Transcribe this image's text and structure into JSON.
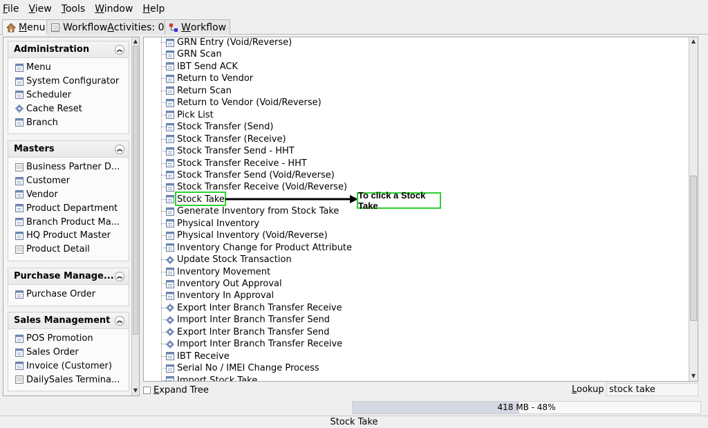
{
  "menubar": {
    "items": [
      {
        "pre": "",
        "u": "F",
        "post": "ile"
      },
      {
        "pre": "",
        "u": "V",
        "post": "iew"
      },
      {
        "pre": "",
        "u": "T",
        "post": "ools"
      },
      {
        "pre": "",
        "u": "W",
        "post": "indow"
      },
      {
        "pre": "",
        "u": "H",
        "post": "elp"
      }
    ]
  },
  "tabs": [
    {
      "pre": "",
      "u": "M",
      "post": "enu",
      "icon": "home-icon"
    },
    {
      "pre": "Workflow ",
      "u": "A",
      "post": "ctivities: 0",
      "icon": "list-icon"
    },
    {
      "pre": "",
      "u": "W",
      "post": "orkflow",
      "icon": "workflow-icon"
    }
  ],
  "sidebar": {
    "sections": [
      {
        "title": "Administration",
        "items": [
          {
            "label": "Menu",
            "icon": "window-icon"
          },
          {
            "label": "System Configurator",
            "icon": "window-icon"
          },
          {
            "label": "Scheduler",
            "icon": "window-icon"
          },
          {
            "label": "Cache Reset",
            "icon": "gear-icon"
          },
          {
            "label": "Branch",
            "icon": "window-icon"
          }
        ]
      },
      {
        "title": "Masters",
        "items": [
          {
            "label": "Business Partner D...",
            "icon": "form-icon"
          },
          {
            "label": "Customer",
            "icon": "window-icon"
          },
          {
            "label": "Vendor",
            "icon": "window-icon"
          },
          {
            "label": "Product Department",
            "icon": "window-icon"
          },
          {
            "label": "Branch Product Ma...",
            "icon": "window-icon"
          },
          {
            "label": "HQ Product Master",
            "icon": "window-icon"
          },
          {
            "label": "Product Detail",
            "icon": "form-icon"
          }
        ]
      },
      {
        "title": "Purchase Manage...",
        "items": [
          {
            "label": "Purchase Order",
            "icon": "window-icon"
          }
        ]
      },
      {
        "title": "Sales Management",
        "items": [
          {
            "label": "POS Promotion",
            "icon": "window-icon"
          },
          {
            "label": "Sales Order",
            "icon": "window-icon"
          },
          {
            "label": "Invoice (Customer)",
            "icon": "window-icon"
          },
          {
            "label": "DailySales Termina...",
            "icon": "form-icon"
          }
        ]
      }
    ]
  },
  "tree": {
    "items": [
      {
        "label": "GRN Entry (Void/Reverse)",
        "icon": "window-icon"
      },
      {
        "label": "GRN Scan",
        "icon": "window-icon"
      },
      {
        "label": "IBT Send ACK",
        "icon": "window-icon"
      },
      {
        "label": "Return to Vendor",
        "icon": "window-icon"
      },
      {
        "label": "Return Scan",
        "icon": "window-icon"
      },
      {
        "label": "Return to Vendor (Void/Reverse)",
        "icon": "window-icon"
      },
      {
        "label": "Pick List",
        "icon": "window-icon"
      },
      {
        "label": "Stock Transfer (Send)",
        "icon": "window-icon"
      },
      {
        "label": "Stock Transfer (Receive)",
        "icon": "window-icon"
      },
      {
        "label": "Stock Transfer Send - HHT",
        "icon": "window-icon"
      },
      {
        "label": "Stock Transfer Receive - HHT",
        "icon": "window-icon"
      },
      {
        "label": "Stock Transfer Send (Void/Reverse)",
        "icon": "window-icon"
      },
      {
        "label": "Stock Transfer Receive (Void/Reverse)",
        "icon": "window-icon"
      },
      {
        "label": "Stock Take",
        "icon": "window-icon"
      },
      {
        "label": "Generate Inventory from Stock Take",
        "icon": "window-icon"
      },
      {
        "label": "Physical Inventory",
        "icon": "window-icon"
      },
      {
        "label": "Physical Inventory (Void/Reverse)",
        "icon": "window-icon"
      },
      {
        "label": "Inventory Change for Product Attribute",
        "icon": "window-icon"
      },
      {
        "label": "Update Stock Transaction",
        "icon": "gear-icon"
      },
      {
        "label": "Inventory Movement",
        "icon": "window-icon"
      },
      {
        "label": "Inventory Out Approval",
        "icon": "window-icon"
      },
      {
        "label": "Inventory In Approval",
        "icon": "window-icon"
      },
      {
        "label": "Export Inter Branch Transfer Receive",
        "icon": "gear-icon"
      },
      {
        "label": "Import Inter Branch Transfer Send",
        "icon": "gear-icon"
      },
      {
        "label": "Export Inter Branch Transfer Send",
        "icon": "gear-icon"
      },
      {
        "label": "Import Inter Branch Transfer Receive",
        "icon": "gear-icon"
      },
      {
        "label": "IBT Receive",
        "icon": "window-icon"
      },
      {
        "label": "Serial No / IMEI Change Process",
        "icon": "window-icon"
      },
      {
        "label": "Import Stock Take",
        "icon": "window-icon"
      }
    ],
    "annotation": "To click a Stock Take"
  },
  "bottom": {
    "expand_pre": "",
    "expand_u": "E",
    "expand_post": "xpand Tree",
    "lookup_pre": "",
    "lookup_u": "L",
    "lookup_post": "ookup",
    "lookup_value": "stock take"
  },
  "memory": {
    "text": "418 MB - 48%",
    "fraction": 0.48
  },
  "status": {
    "text": "Stock Take"
  },
  "colors": {
    "highlight": "#2fcf2f",
    "memory_fill": "#d3d8e2"
  }
}
